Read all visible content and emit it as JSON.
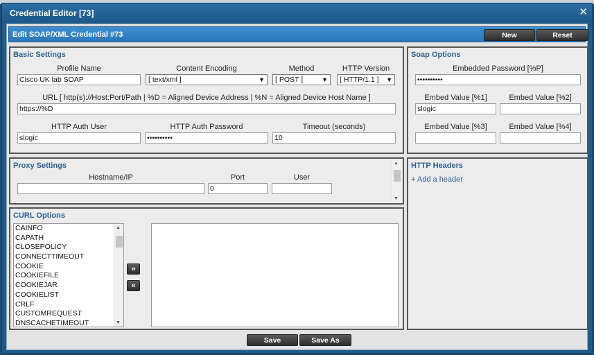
{
  "window": {
    "title": "Credential Editor [73]"
  },
  "header": {
    "title": "Edit SOAP/XML Credential #73",
    "new_label": "New",
    "reset_label": "Reset"
  },
  "basic": {
    "title": "Basic Settings",
    "profile_name_label": "Profile Name",
    "profile_name_value": "Cisco UK lab SOAP",
    "encoding_label": "Content Encoding",
    "encoding_value": "[ text/xml ]",
    "method_label": "Method",
    "method_value": "[ POST ]",
    "http_version_label": "HTTP Version",
    "http_version_value": "[ HTTP/1.1 ]",
    "url_label": "URL [ http(s)://Host:Port/Path | %D = Aligned Device Address | %N = Aligned Device Host Name ]",
    "url_value": "https://%D",
    "auth_user_label": "HTTP Auth User",
    "auth_user_value": "slogic",
    "auth_password_label": "HTTP Auth Password",
    "auth_password_value": "••••••••••",
    "timeout_label": "Timeout (seconds)",
    "timeout_value": "10"
  },
  "soap": {
    "title": "Soap Options",
    "embedded_password_label": "Embedded Password [%P]",
    "embedded_password_value": "••••••••••",
    "embed1_label": "Embed Value [%1]",
    "embed1_value": "slogic",
    "embed2_label": "Embed Value [%2]",
    "embed2_value": "",
    "embed3_label": "Embed Value [%3]",
    "embed3_value": "",
    "embed4_label": "Embed Value [%4]",
    "embed4_value": ""
  },
  "proxy": {
    "title": "Proxy Settings",
    "hostname_label": "Hostname/IP",
    "hostname_value": "",
    "port_label": "Port",
    "port_value": "0",
    "user_label": "User",
    "user_value": ""
  },
  "http_headers": {
    "title": "HTTP Headers",
    "add_label": "Add a header"
  },
  "curl": {
    "title": "CURL Options",
    "options": [
      "CAINFO",
      "CAPATH",
      "CLOSEPOLICY",
      "CONNECTTIMEOUT",
      "COOKIE",
      "COOKIEFILE",
      "COOKIEJAR",
      "COOKIELIST",
      "CRLF",
      "CUSTOMREQUEST",
      "DNSCACHETIMEOUT"
    ],
    "add_label": "»",
    "remove_label": "«"
  },
  "footer": {
    "save_label": "Save",
    "save_as_label": "Save As"
  },
  "icons": {
    "close": "close-icon",
    "plus": "plus-icon",
    "dropdown": "chevron-down-icon"
  }
}
